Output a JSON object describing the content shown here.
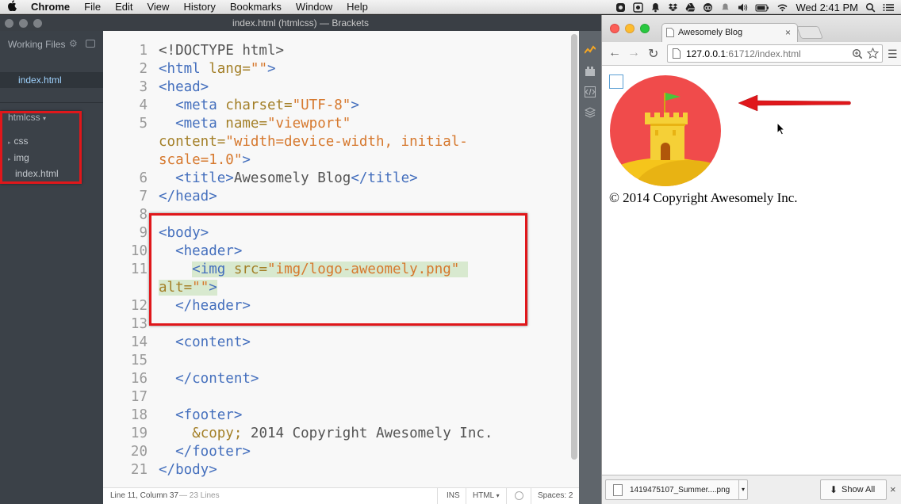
{
  "menubar": {
    "app": "Chrome",
    "items": [
      "File",
      "Edit",
      "View",
      "History",
      "Bookmarks",
      "Window",
      "Help"
    ],
    "clock": "Wed 2:41 PM"
  },
  "brackets": {
    "window_title": "index.html (htmlcss) — Brackets",
    "working_files_label": "Working Files",
    "active_file": "index.html",
    "project_name": "htmlcss",
    "tree": [
      "css",
      "img",
      "index.html"
    ],
    "code": {
      "line_numbers": [
        "1",
        "2",
        "3",
        "4",
        "5",
        "",
        "",
        "6",
        "7",
        "8",
        "9",
        "10",
        "11",
        "",
        "12",
        "13",
        "14",
        "15",
        "16",
        "17",
        "18",
        "19",
        "20",
        "21"
      ],
      "doctype": "<!DOCTYPE html>",
      "html_open": "<html",
      "lang_attr": " lang=",
      "lang_val": "\"\"",
      "gt": ">",
      "head_open": "<head>",
      "meta_open": "<meta",
      "charset_attr": " charset=",
      "charset_val": "\"UTF-8\"",
      "name_attr": " name=",
      "name_val": "\"viewport\"",
      "content_attr": "content=",
      "content_val1": "\"width=device-width, initial-",
      "content_val2": "scale=1.0\"",
      "title_open": "<title>",
      "title_text": "Awesomely Blog",
      "title_close": "</title>",
      "head_close": "</head>",
      "body_open": "<body>",
      "header_open": "<header>",
      "img_open": "<img",
      "src_attr": " src=",
      "src_val": "\"img/logo-aweomely.png\"",
      "alt_attr": "alt=",
      "alt_val": "\"\"",
      "header_close": "</header>",
      "content_open": "<content>",
      "content_close": "</content>",
      "footer_open": "<footer>",
      "copy_entity": "&copy;",
      "footer_text": " 2014 Copyright Awesomely Inc.",
      "footer_close": "</footer>",
      "body_close": "</body>"
    },
    "status": {
      "position": "Line 11, Column 37",
      "lines": "— 23 Lines",
      "mode": "INS",
      "language": "HTML",
      "spaces": "Spaces:  2"
    }
  },
  "chrome": {
    "tab_title": "Awesomely Blog",
    "url_host": "127.0.0.1",
    "url_rest": ":61712/index.html",
    "page_footer": "© 2014 Copyright Awesomely Inc.",
    "download_file": "1419475107_Summer....png",
    "show_all": "Show All"
  },
  "colors": {
    "annotation_red": "#e0171b",
    "logo_red": "#f04b4b",
    "logo_yellow": "#f5c51b",
    "flag_green": "#4cc33b"
  }
}
